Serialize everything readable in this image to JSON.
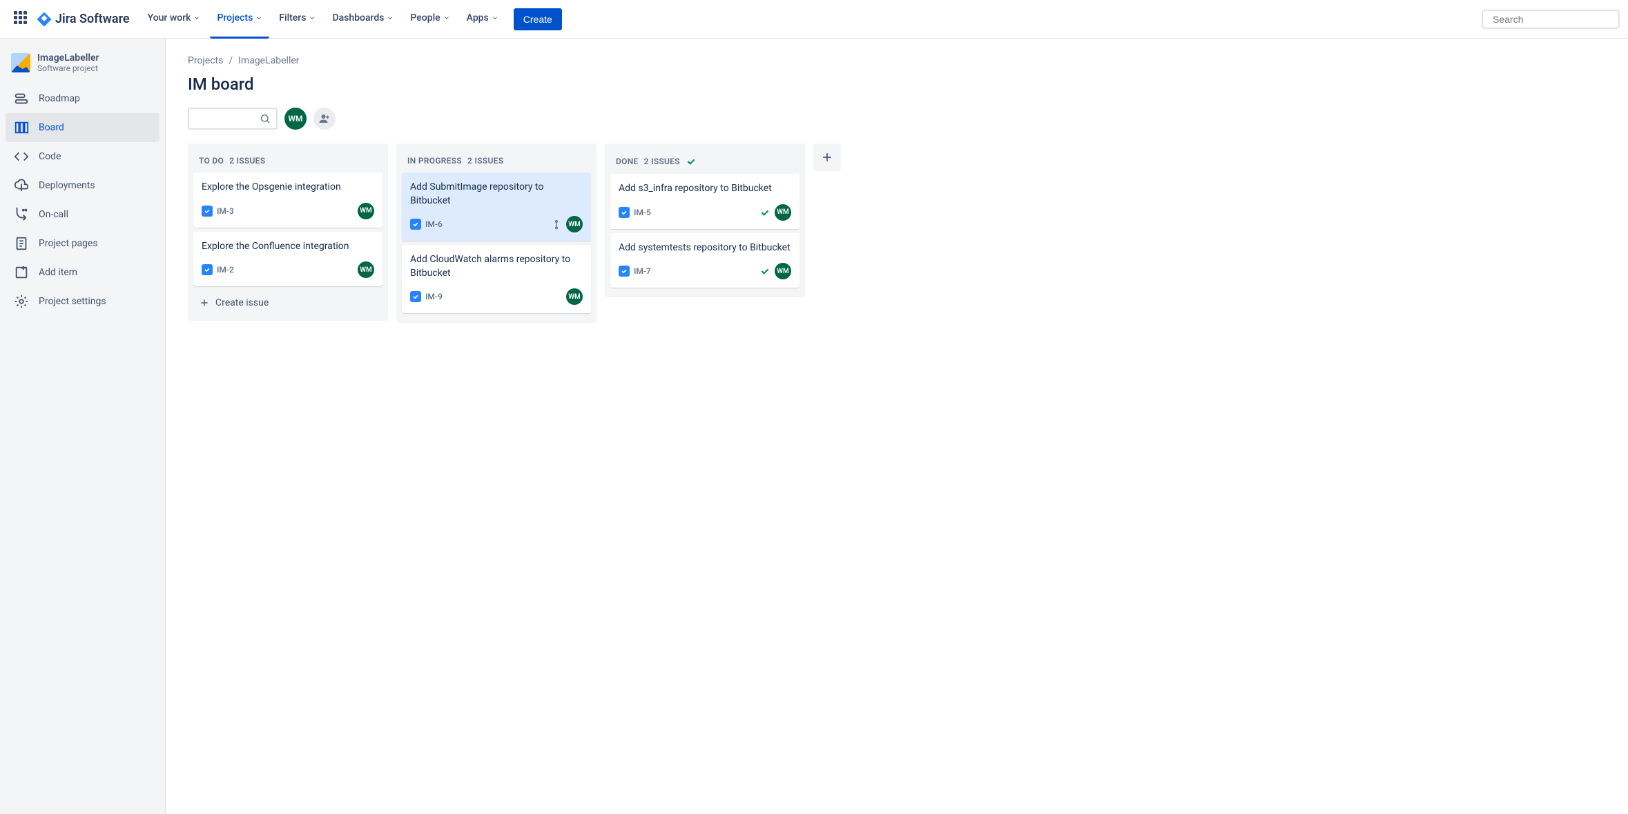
{
  "header": {
    "logo_text": "Jira Software",
    "nav": [
      "Your work",
      "Projects",
      "Filters",
      "Dashboards",
      "People",
      "Apps"
    ],
    "active_nav_index": 1,
    "create_label": "Create",
    "search_placeholder": "Search"
  },
  "sidebar": {
    "project_name": "ImageLabeller",
    "project_type": "Software project",
    "items": [
      "Roadmap",
      "Board",
      "Code",
      "Deployments",
      "On-call",
      "Project pages",
      "Add item",
      "Project settings"
    ],
    "active_index": 1
  },
  "breadcrumb": [
    "Projects",
    "ImageLabeller"
  ],
  "page_title": "IM board",
  "filter_avatar": "WM",
  "columns": [
    {
      "name": "TO DO",
      "count_label": "2 ISSUES",
      "done": false,
      "cards": [
        {
          "title": "Explore the Opsgenie integration",
          "key": "IM-3",
          "assignee": "WM",
          "highlighted": false,
          "done": false,
          "priority": false
        },
        {
          "title": "Explore the Confluence integration",
          "key": "IM-2",
          "assignee": "WM",
          "highlighted": false,
          "done": false,
          "priority": false
        }
      ],
      "show_create": true
    },
    {
      "name": "IN PROGRESS",
      "count_label": "2 ISSUES",
      "done": false,
      "cards": [
        {
          "title": "Add SubmitImage repository to Bitbucket",
          "key": "IM-6",
          "assignee": "WM",
          "highlighted": true,
          "done": false,
          "priority": true
        },
        {
          "title": "Add CloudWatch alarms repository to Bitbucket",
          "key": "IM-9",
          "assignee": "WM",
          "highlighted": false,
          "done": false,
          "priority": false
        }
      ],
      "show_create": false
    },
    {
      "name": "DONE",
      "count_label": "2 ISSUES",
      "done": true,
      "cards": [
        {
          "title": "Add s3_infra repository to Bitbucket",
          "key": "IM-5",
          "assignee": "WM",
          "highlighted": false,
          "done": true,
          "priority": false
        },
        {
          "title": "Add systemtests repository to Bitbucket",
          "key": "IM-7",
          "assignee": "WM",
          "highlighted": false,
          "done": true,
          "priority": false
        }
      ],
      "show_create": false
    }
  ],
  "create_issue_label": "Create issue"
}
